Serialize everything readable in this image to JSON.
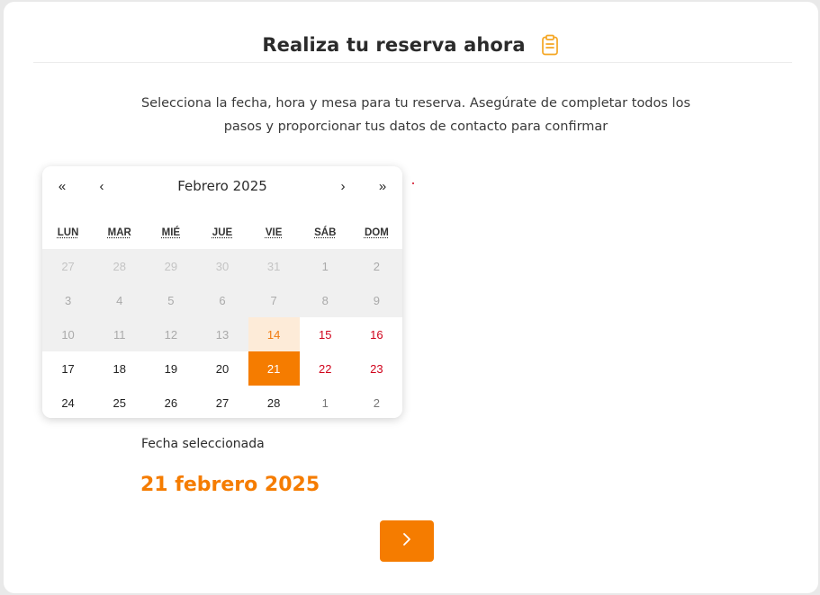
{
  "header": {
    "title": "Realiza tu reserva ahora",
    "icon": "clipboard-icon",
    "accent": "#f57c00"
  },
  "intro": {
    "line1": "Selecciona la fecha, hora y mesa para tu reserva. Asegúrate de completar todos los",
    "line2": "pasos y proporcionar tus datos de contacto para confirmar"
  },
  "calendar": {
    "prev_year": "«",
    "prev_month": "‹",
    "month_label": "Febrero 2025",
    "next_month": "›",
    "next_year": "»",
    "weekdays": [
      "LUN",
      "MAR",
      "MIÉ",
      "JUE",
      "VIE",
      "SÁB",
      "DOM"
    ],
    "weeks": [
      [
        "27",
        "28",
        "29",
        "30",
        "31",
        "1",
        "2"
      ],
      [
        "3",
        "4",
        "5",
        "6",
        "7",
        "8",
        "9"
      ],
      [
        "10",
        "11",
        "12",
        "13",
        "14",
        "15",
        "16"
      ],
      [
        "17",
        "18",
        "19",
        "20",
        "21",
        "22",
        "23"
      ],
      [
        "24",
        "25",
        "26",
        "27",
        "28",
        "1",
        "2"
      ]
    ],
    "today": "14",
    "selected": "21",
    "selected_color": "#f57c00",
    "weekend_color": "#d0021b"
  },
  "selection": {
    "label": "Fecha seleccionada",
    "value": "21 febrero 2025"
  },
  "next_button": {
    "icon": "chevron-right-icon"
  }
}
